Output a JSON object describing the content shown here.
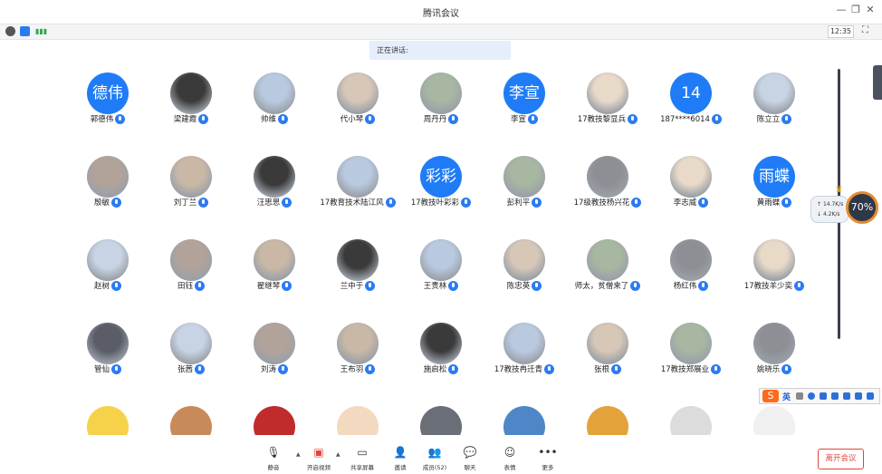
{
  "window": {
    "title": "腾讯会议"
  },
  "statusbar": {
    "clock": "12:35"
  },
  "speaking": {
    "label": "正在讲话:"
  },
  "participants": [
    {
      "name": "郭德伟",
      "avatar_text": "德伟"
    },
    {
      "name": "梁建霞",
      "avatar_text": ""
    },
    {
      "name": "帅维",
      "avatar_text": ""
    },
    {
      "name": "代小琴",
      "avatar_text": ""
    },
    {
      "name": "周丹丹",
      "avatar_text": ""
    },
    {
      "name": "李宣",
      "avatar_text": "李宣"
    },
    {
      "name": "17教技黎显兵",
      "avatar_text": ""
    },
    {
      "name": "187****6014",
      "avatar_text": "14"
    },
    {
      "name": "陈立立",
      "avatar_text": ""
    },
    {
      "name": "殷敏",
      "avatar_text": ""
    },
    {
      "name": "刘丁兰",
      "avatar_text": ""
    },
    {
      "name": "汪思思",
      "avatar_text": ""
    },
    {
      "name": "17教育技术陆江风",
      "avatar_text": ""
    },
    {
      "name": "17教技叶彩彩",
      "avatar_text": "彩彩"
    },
    {
      "name": "彭利平",
      "avatar_text": ""
    },
    {
      "name": "17级教技杨兴花",
      "avatar_text": ""
    },
    {
      "name": "李志威",
      "avatar_text": ""
    },
    {
      "name": "黄雨蝶",
      "avatar_text": "雨蝶"
    },
    {
      "name": "赵树",
      "avatar_text": ""
    },
    {
      "name": "田钰",
      "avatar_text": ""
    },
    {
      "name": "翟继琴",
      "avatar_text": ""
    },
    {
      "name": "兰中于",
      "avatar_text": ""
    },
    {
      "name": "王贵林",
      "avatar_text": ""
    },
    {
      "name": "陈忠英",
      "avatar_text": ""
    },
    {
      "name": "师太，贫僧来了",
      "avatar_text": ""
    },
    {
      "name": "杨红伟",
      "avatar_text": ""
    },
    {
      "name": "17教技羊少奕",
      "avatar_text": ""
    },
    {
      "name": "管仙",
      "avatar_text": ""
    },
    {
      "name": "张茜",
      "avatar_text": ""
    },
    {
      "name": "刘涛",
      "avatar_text": ""
    },
    {
      "name": "王布羽",
      "avatar_text": ""
    },
    {
      "name": "施启松",
      "avatar_text": ""
    },
    {
      "name": "17教技冉迁青",
      "avatar_text": ""
    },
    {
      "name": "张根",
      "avatar_text": ""
    },
    {
      "name": "17教技郑展业",
      "avatar_text": ""
    },
    {
      "name": "姚晓乐",
      "avatar_text": ""
    }
  ],
  "monitor": {
    "upload": "14.7K/s",
    "download": "4.2K/s",
    "cpu": "70%"
  },
  "ime": {
    "mode": "英"
  },
  "toolbar": {
    "mute": "静音",
    "video": "开启视频",
    "share": "共享屏幕",
    "invite": "邀请",
    "members": "成员(52)",
    "chat": "聊天",
    "reactions": "表情",
    "more": "更多",
    "leave": "离开会议"
  }
}
